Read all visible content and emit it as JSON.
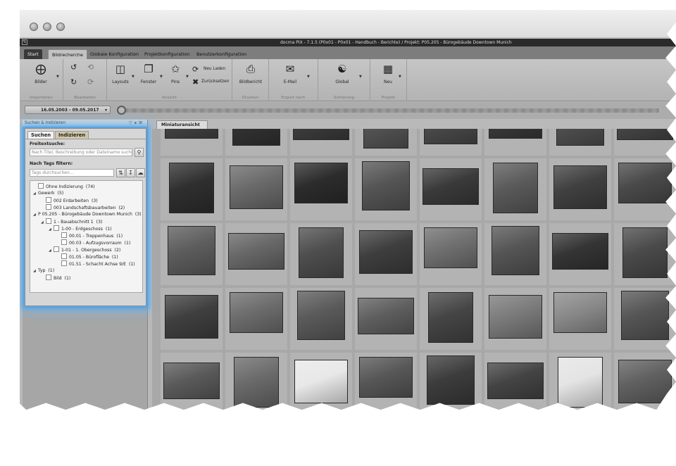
{
  "window": {
    "title": "docma PIX - 7.1.5 (P0x01 - P0x01 - Handbuch - Berichte) / Projekt: P05.205 - Bürogebäude Downtown Munich"
  },
  "ribbon_tabs": [
    "Start",
    "Bildrecherche",
    "Globale Konfiguration",
    "Projektkonfiguration",
    "Benutzerkonfiguration"
  ],
  "ribbon": {
    "import": {
      "bilder": "Bilder",
      "group": "Importieren"
    },
    "edit": {
      "group": "Bearbeiten"
    },
    "view": {
      "layouts": "Layouts",
      "fenster": "Fenster",
      "pins": "Pins",
      "neu_laden": "Neu Laden",
      "zuruecksetzen": "Zurücksetzen",
      "group": "Ansicht"
    },
    "print": {
      "bildbericht": "Bildbericht",
      "group": "Drucken"
    },
    "export": {
      "email": "E-Mail",
      "group": "Export nach"
    },
    "sort": {
      "global": "Global",
      "group": "Sortierung"
    },
    "project": {
      "neu": "Neu",
      "group": "Projekt"
    }
  },
  "date_range": "16.05.2003 - 09.05.2017",
  "panel": {
    "title": "Suchen & Indizieren",
    "tabs": [
      "Suchen",
      "Indizieren"
    ],
    "freetext_label": "Freitextsuche:",
    "freetext_placeholder": "Nach Titel, Beschreibung oder Dateiname suchen...",
    "tags_label": "Nach Tags filtern:",
    "tags_placeholder": "Tags durchsuchen..."
  },
  "tree": [
    {
      "label": "Ohne Indizierung",
      "count": "(74)"
    },
    {
      "label": "Gewerk",
      "count": "(5)"
    },
    {
      "label": "002 Erdarbeiten",
      "count": "(3)"
    },
    {
      "label": "003 Landschaftsbauarbeiten",
      "count": "(2)"
    },
    {
      "label": "P 05.205 - Bürogebäude Downtown Munich",
      "count": "(3)"
    },
    {
      "label": "1 - Bauabschnitt 1",
      "count": "(3)"
    },
    {
      "label": "1-00 - Erdgeschoss",
      "count": "(1)"
    },
    {
      "label": "00.01 - Treppenhaus",
      "count": "(1)"
    },
    {
      "label": "00.03 - Aufzugsvorraum",
      "count": "(1)"
    },
    {
      "label": "1-01 - 1. Obergeschoss",
      "count": "(2)"
    },
    {
      "label": "01.05 - Bürofläche",
      "count": "(1)"
    },
    {
      "label": "01.51 - Schacht Achse 9/E",
      "count": "(1)"
    },
    {
      "label": "Typ",
      "count": "(1)"
    },
    {
      "label": "Bild",
      "count": "(1)"
    }
  ],
  "content_tab": "Miniaturansicht",
  "thumbnail_tones": [
    [
      "#444",
      "#333",
      "#3c3c3c",
      "#555",
      "#4a4a4a",
      "#3a3a3a",
      "#505050",
      "#454545"
    ],
    [
      "#2f2f2f",
      "#6a6a6a",
      "#2c2c2c",
      "#555",
      "#3a3a3a",
      "#5a5a5a",
      "#404040",
      "#4a4a4a"
    ],
    [
      "#5d5d5d",
      "#676767",
      "#4e4e4e",
      "#3e3e3e",
      "#707070",
      "#555",
      "#343434",
      "#4a4a4a"
    ],
    [
      "#3f3f3f",
      "#6d6d6d",
      "#5a5a5a",
      "#5e5e5e",
      "#454545",
      "#7a7a7a",
      "#8a8a8a",
      "#555"
    ],
    [
      "#5a5a5a",
      "#6a6a6a",
      "#e8e8e8",
      "#575757",
      "#3c3c3c",
      "#444",
      "#e4e4e4",
      "#606060"
    ]
  ]
}
